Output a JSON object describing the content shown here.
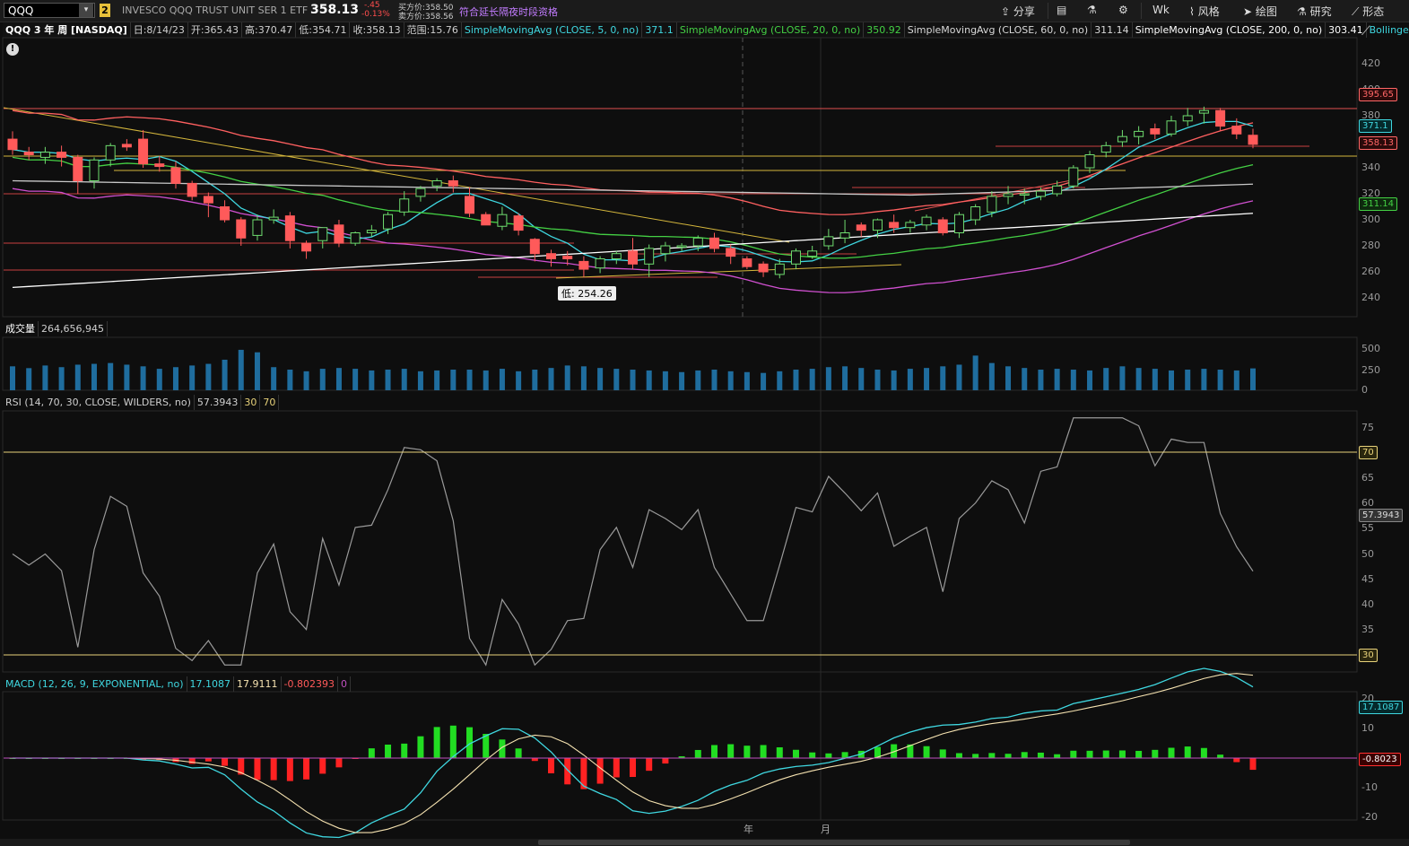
{
  "toolbar": {
    "symbol": "QQQ",
    "link_badge": "2",
    "description": "INVESCO QQQ TRUST UNIT SER 1 ETF",
    "last_price": "358.13",
    "net_change": "-.45",
    "pct_change": "-0.13%",
    "bid": "买方价:358.50",
    "ask": "卖方价:358.56",
    "extended_hours": "符合延长隔夜时段资格",
    "share": "分享",
    "timeframe": "Wk",
    "style": "风格",
    "drawings": "绘图",
    "studies": "研究",
    "patterns": "形态"
  },
  "price_header": {
    "title": "QQQ 3 年 周 [NASDAQ]",
    "date": "日:8/14/23",
    "open": "开:365.43",
    "high": "高:370.47",
    "low": "低:354.71",
    "close": "收:358.13",
    "range": "范围:15.76",
    "sma5_label": "SimpleMovingAvg (CLOSE, 5, 0, no)",
    "sma5_value": "371.1",
    "sma20_label": "SimpleMovingAvg (CLOSE, 20, 0, no)",
    "sma20_value": "350.92",
    "sma60_label": "SimpleMovingAvg (CLOSE, 60, 0, no)",
    "sma60_value": "311.14",
    "sma200_label": "SimpleMovingAvg (CLOSE, 200, 0, no)",
    "sma200_value": "303.41",
    "bollinger": "Bollinger..."
  },
  "price_axis": {
    "ticks": [
      "420",
      "400",
      "380",
      "360",
      "340",
      "320",
      "300",
      "280",
      "260",
      "240"
    ],
    "tags": {
      "upper_band": "395.65",
      "sma5": "371.1",
      "last": "358.13",
      "sma60": "311.14"
    }
  },
  "low_callout": "低: 254.26",
  "volume_header": {
    "label": "成交量",
    "value": "264,656,945"
  },
  "volume_axis": {
    "ticks": [
      "500",
      "250",
      "0"
    ]
  },
  "rsi_header": {
    "label": "RSI (14, 70, 30, CLOSE, WILDERS, no)",
    "value": "57.3943",
    "oversold": "30",
    "overbought": "70"
  },
  "rsi_axis": {
    "ticks": [
      "75",
      "70",
      "65",
      "60",
      "55",
      "50",
      "45",
      "40",
      "35",
      "30"
    ],
    "tag_value": "57.3943",
    "tag_70": "70",
    "tag_30": "30"
  },
  "macd_header": {
    "label": "MACD (12, 26, 9, EXPONENTIAL, no)",
    "value": "17.1087",
    "avg": "17.9111",
    "diff": "-0.802393",
    "zero": "0"
  },
  "macd_axis": {
    "ticks": [
      "20",
      "10",
      "0",
      "-10",
      "-20"
    ],
    "tag_value": "17.1087",
    "tag_diff": "-0.8023"
  },
  "time_axis": {
    "labels": [
      "年",
      "月"
    ]
  },
  "colors": {
    "up": "#6fdc6f",
    "down": "#ff5a5a",
    "sma5": "#3fd7e0",
    "sma20": "#44d044",
    "sma60": "#c8c8c8",
    "bollinger": "#ff6060",
    "volume": "#1f6d9e",
    "rsi": "#9a9a9a",
    "rsi_over": "#ff5a5a",
    "macd": "#3fd7e0",
    "macd_avg": "#f5e2b0"
  },
  "chart_data": {
    "type": "candlestick",
    "candles": [
      [
        362,
        354,
        368,
        350
      ],
      [
        352,
        350,
        356,
        346
      ],
      [
        348,
        352,
        356,
        343
      ],
      [
        352,
        348,
        357,
        341
      ],
      [
        348,
        330,
        350,
        320
      ],
      [
        330,
        346,
        348,
        324
      ],
      [
        346,
        357,
        359,
        341
      ],
      [
        358,
        356,
        362,
        353
      ],
      [
        362,
        343,
        369,
        340
      ],
      [
        343,
        341,
        349,
        337
      ],
      [
        340,
        328,
        345,
        324
      ],
      [
        328,
        318,
        330,
        315
      ],
      [
        318,
        313,
        321,
        302
      ],
      [
        310,
        300,
        315,
        298
      ],
      [
        300,
        286,
        302,
        280
      ],
      [
        288,
        300,
        304,
        284
      ],
      [
        300,
        302,
        308,
        297
      ],
      [
        303,
        284,
        306,
        278
      ],
      [
        282,
        276,
        284,
        270
      ],
      [
        284,
        294,
        294,
        278
      ],
      [
        296,
        282,
        300,
        279
      ],
      [
        282,
        290,
        291,
        280
      ],
      [
        290,
        292,
        296,
        287
      ],
      [
        293,
        304,
        306,
        289
      ],
      [
        306,
        316,
        322,
        303
      ],
      [
        318,
        324,
        326,
        314
      ],
      [
        326,
        330,
        332,
        322
      ],
      [
        330,
        326,
        334,
        321
      ],
      [
        318,
        305,
        325,
        302
      ],
      [
        304,
        296,
        306,
        296
      ],
      [
        295,
        304,
        310,
        292
      ],
      [
        303,
        292,
        305,
        288
      ],
      [
        285,
        274,
        286,
        268
      ],
      [
        274,
        270,
        277,
        264
      ],
      [
        272,
        270,
        276,
        265
      ],
      [
        268,
        262,
        272,
        256
      ],
      [
        263,
        270,
        272,
        259
      ],
      [
        270,
        274,
        276,
        266
      ],
      [
        276,
        266,
        286,
        262
      ],
      [
        266,
        278,
        281,
        256
      ],
      [
        274,
        280,
        283,
        268
      ],
      [
        280,
        280,
        282,
        276
      ],
      [
        280,
        286,
        288,
        276
      ],
      [
        286,
        278,
        290,
        275
      ],
      [
        278,
        272,
        281,
        266
      ],
      [
        270,
        264,
        272,
        262
      ],
      [
        266,
        260,
        268,
        256
      ],
      [
        258,
        266,
        270,
        255
      ],
      [
        266,
        276,
        278,
        262
      ],
      [
        272,
        276,
        280,
        270
      ],
      [
        280,
        287,
        293,
        277
      ],
      [
        286,
        290,
        300,
        282
      ],
      [
        296,
        292,
        298,
        287
      ],
      [
        292,
        300,
        301,
        286
      ],
      [
        298,
        294,
        304,
        290
      ],
      [
        294,
        298,
        300,
        290
      ],
      [
        296,
        302,
        304,
        292
      ],
      [
        300,
        290,
        302,
        288
      ],
      [
        290,
        304,
        306,
        286
      ],
      [
        300,
        310,
        312,
        296
      ],
      [
        306,
        318,
        322,
        302
      ],
      [
        318,
        320,
        326,
        312
      ],
      [
        320,
        320,
        324,
        312
      ],
      [
        318,
        322,
        325,
        315
      ],
      [
        320,
        326,
        330,
        318
      ],
      [
        326,
        340,
        342,
        324
      ],
      [
        340,
        350,
        353,
        336
      ],
      [
        352,
        357,
        360,
        348
      ],
      [
        360,
        364,
        369,
        356
      ],
      [
        364,
        368,
        372,
        358
      ],
      [
        370,
        366,
        374,
        362
      ],
      [
        366,
        376,
        380,
        364
      ],
      [
        376,
        380,
        386,
        372
      ],
      [
        382,
        384,
        387,
        374
      ],
      [
        384,
        372,
        386,
        368
      ],
      [
        372,
        366,
        378,
        362
      ],
      [
        365,
        358,
        370,
        355
      ]
    ],
    "volume": [
      290,
      268,
      300,
      280,
      310,
      320,
      330,
      310,
      290,
      260,
      280,
      300,
      320,
      370,
      490,
      460,
      280,
      250,
      230,
      260,
      270,
      260,
      240,
      250,
      260,
      230,
      240,
      250,
      250,
      240,
      260,
      230,
      250,
      270,
      300,
      290,
      270,
      260,
      250,
      240,
      230,
      220,
      240,
      250,
      230,
      220,
      210,
      230,
      250,
      260,
      280,
      290,
      270,
      250,
      240,
      260,
      270,
      290,
      310,
      420,
      330,
      290,
      270,
      250,
      260,
      250,
      240,
      270,
      290,
      270,
      260,
      240,
      250,
      260,
      250,
      240,
      265
    ],
    "sma5_ylim": [
      230,
      425
    ]
  }
}
